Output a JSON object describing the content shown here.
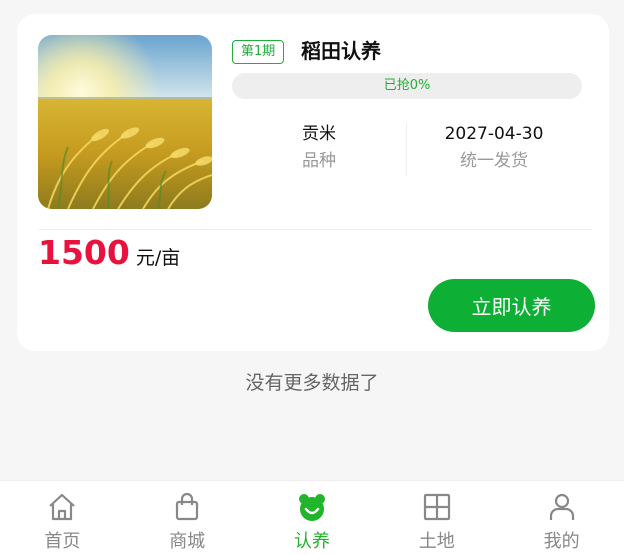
{
  "product": {
    "image_alt": "golden rice field at sunrise",
    "period_badge": "第1期",
    "title": "稻田认养",
    "progress": {
      "text": "已抢0%",
      "fraction": 0.0
    },
    "variety": {
      "value": "贡米",
      "label": "品种"
    },
    "shipping": {
      "value": "2027-04-30",
      "label": "统一发货"
    },
    "price": "1500",
    "price_unit": "元/亩",
    "cta_label": "立即认养"
  },
  "list_end_text": "没有更多数据了",
  "tabbar": {
    "items": [
      {
        "label": "首页",
        "icon": "home-icon",
        "active": false
      },
      {
        "label": "商城",
        "icon": "shopping-bag-icon",
        "active": false
      },
      {
        "label": "认养",
        "icon": "adopt-face-icon",
        "active": true
      },
      {
        "label": "土地",
        "icon": "land-grid-icon",
        "active": false
      },
      {
        "label": "我的",
        "icon": "user-icon",
        "active": false
      }
    ]
  },
  "colors": {
    "accent_green": "#22ad38",
    "button_green": "#0db034",
    "price_red": "#e8123c",
    "tab_active": "#20b52a",
    "tab_inactive": "#888888"
  }
}
